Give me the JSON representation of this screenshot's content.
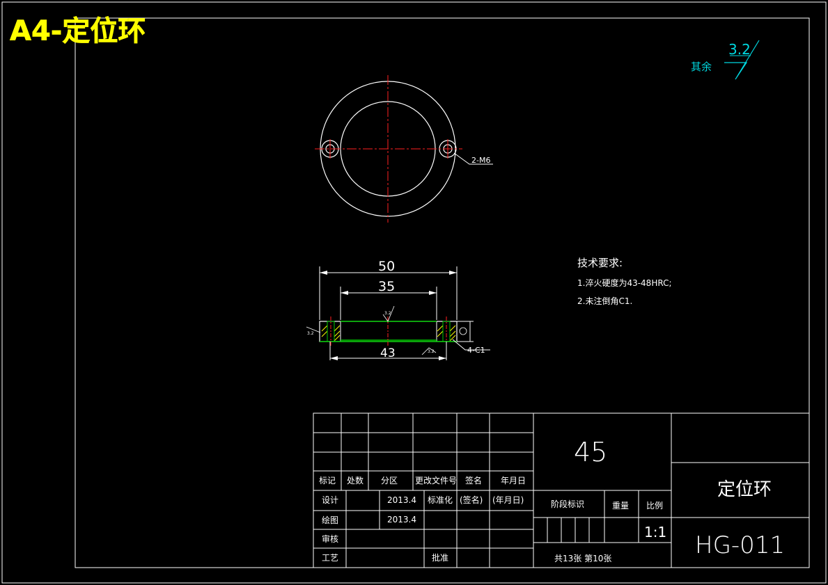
{
  "sheet": {
    "title_overlay": "A4-定位环"
  },
  "roughness": {
    "label": "其余",
    "value": "3.2"
  },
  "top_view": {
    "hole_callout": "2-M6"
  },
  "section_view": {
    "dim_outer": "50",
    "dim_inner": "35",
    "dim_bottom": "43",
    "chamfer_callout": "4-C1",
    "small_mark_1": "3.2",
    "small_mark_2": "3.2",
    "small_mark_3": "3.2"
  },
  "tech_requirements": {
    "heading": "技术要求:",
    "item1": "1.淬火硬度为43-48HRC;",
    "item2": "2.未注倒角C1."
  },
  "title_block": {
    "col_headers": [
      "标记",
      "处数",
      "分区",
      "更改文件号",
      "签名",
      "年月日"
    ],
    "row_design": {
      "label": "设计",
      "date": "2013.4",
      "std_label": "标准化",
      "sign": "(签名)",
      "ymd": "(年月日)"
    },
    "row_draw": {
      "label": "绘图",
      "date": "2013.4"
    },
    "row_check": {
      "label": "审核"
    },
    "row_process": {
      "label": "工艺",
      "approve": "批准"
    },
    "material": "45",
    "stage_label": "阶段标识",
    "weight_label": "重量",
    "scale_label": "比例",
    "scale_value": "1:1",
    "sheets": "共13张   第10张",
    "part_name": "定位环",
    "drawing_no": "HG-011"
  },
  "colors": {
    "line": "#ffffff",
    "center": "#ff2020",
    "dim": "#ffffff",
    "section": "#00c800",
    "hatch": "#ffff00",
    "roughness": "#00d8e0",
    "title": "#ffff00"
  }
}
